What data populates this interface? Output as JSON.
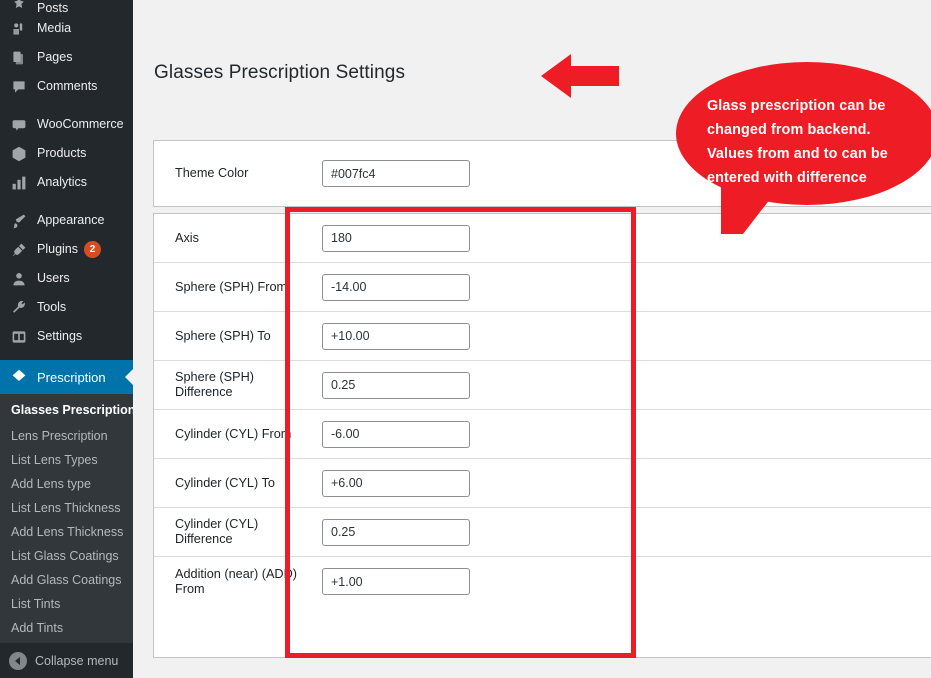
{
  "sidebar": {
    "items": [
      {
        "label": "Posts",
        "icon": "pin-icon",
        "clipped": true
      },
      {
        "label": "Media",
        "icon": "media-icon"
      },
      {
        "label": "Pages",
        "icon": "pages-icon"
      },
      {
        "label": "Comments",
        "icon": "comments-icon"
      },
      {
        "label": "WooCommerce",
        "icon": "woocommerce-icon"
      },
      {
        "label": "Products",
        "icon": "products-box-icon"
      },
      {
        "label": "Analytics",
        "icon": "analytics-bars-icon"
      },
      {
        "label": "Appearance",
        "icon": "appearance-brush-icon"
      },
      {
        "label": "Plugins",
        "icon": "plugins-plug-icon",
        "badge": "2"
      },
      {
        "label": "Users",
        "icon": "users-icon"
      },
      {
        "label": "Tools",
        "icon": "tools-wrench-icon"
      },
      {
        "label": "Settings",
        "icon": "settings-sliders-icon"
      }
    ],
    "active_item": {
      "label": "Prescription",
      "icon": "prescription-glasses-icon"
    },
    "submenu": [
      {
        "label": "Glasses Prescription",
        "current": true
      },
      {
        "label": "Lens Prescription",
        "current": false
      },
      {
        "label": "List Lens Types",
        "current": false
      },
      {
        "label": "Add Lens type",
        "current": false
      },
      {
        "label": "List Lens Thickness",
        "current": false
      },
      {
        "label": "Add Lens Thickness",
        "current": false
      },
      {
        "label": "List Glass Coatings",
        "current": false
      },
      {
        "label": "Add Glass Coatings",
        "current": false
      },
      {
        "label": "List Tints",
        "current": false
      },
      {
        "label": "Add Tints",
        "current": false
      }
    ],
    "collapse_label": "Collapse menu",
    "background": "#23282d",
    "submenu_background": "#32373c",
    "active_background": "#0073aa",
    "badge_color": "#d54e21"
  },
  "main": {
    "page_title": "Glasses Prescription Settings",
    "theme_card": {
      "label": "Theme Color",
      "value": "#007fc4"
    },
    "prescription_fields": [
      {
        "label": "Axis",
        "value": "180"
      },
      {
        "label": "Sphere (SPH) From",
        "value": "-14.00"
      },
      {
        "label": "Sphere (SPH) To",
        "value": "+10.00"
      },
      {
        "label": "Sphere (SPH) Difference",
        "value": "0.25"
      },
      {
        "label": "Cylinder (CYL) From",
        "value": "-6.00"
      },
      {
        "label": "Cylinder (CYL) To",
        "value": "+6.00"
      },
      {
        "label": "Cylinder (CYL) Difference",
        "value": "0.25"
      },
      {
        "label": "Addition (near) (ADD) From",
        "value": "+1.00"
      }
    ]
  },
  "annotations": {
    "callout_text": "Glass prescription can be\nchanged from backend.\nValues from and to can be\nentered with difference",
    "callout_color": "#ee1c25",
    "arrow_color": "#ee1c25",
    "highlight_box_color": "#ee1c25"
  }
}
